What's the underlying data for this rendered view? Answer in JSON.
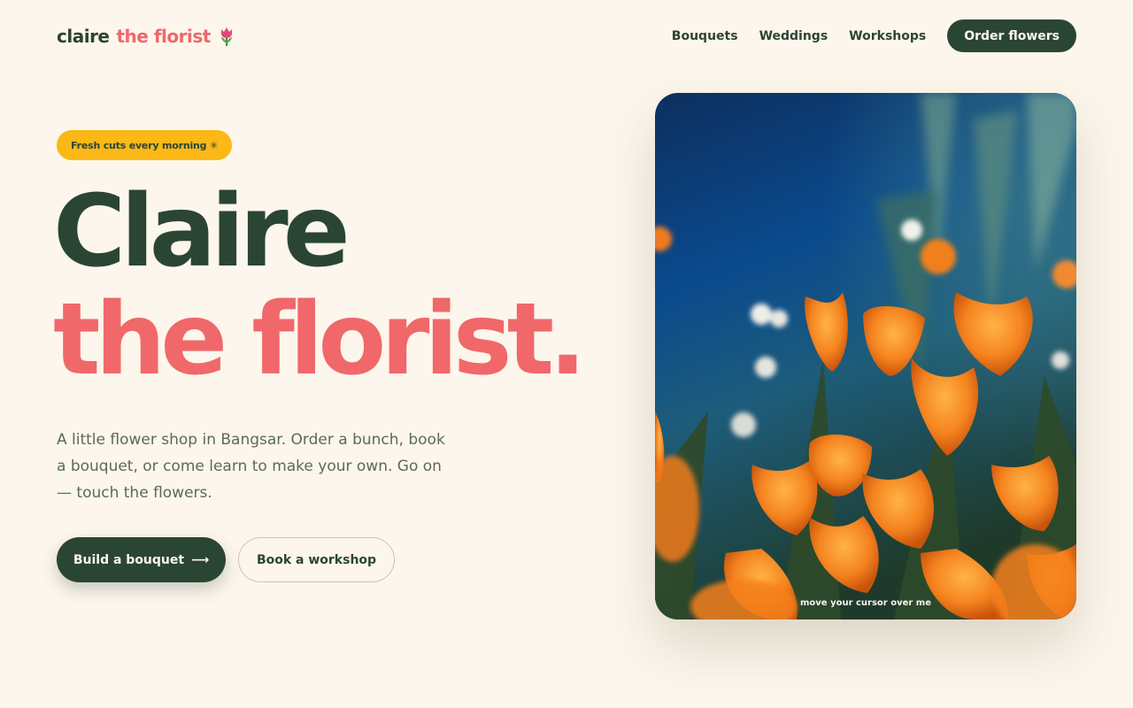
{
  "brand": {
    "part1": "claire",
    "part2": "the florist",
    "icon": "tulip-icon"
  },
  "nav": {
    "links": [
      "Bouquets",
      "Weddings",
      "Workshops"
    ],
    "cta": "Order flowers"
  },
  "hero": {
    "badge": "Fresh cuts every morning ✳",
    "title_line1": "Claire",
    "title_line2": "the florist.",
    "lead": "A little flower shop in Bangsar. Order a bunch, book a bouquet, or come learn to make your own. Go on — touch the flowers.",
    "primary_button": "Build a bouquet",
    "primary_arrow": "⟶",
    "secondary_button": "Book a workshop"
  },
  "photo": {
    "hint": "move your cursor over me",
    "subject": "orange poppies under blue sky"
  },
  "colors": {
    "background": "#fdf6ec",
    "green": "#2b4535",
    "coral": "#f0686a",
    "yellow": "#fbb817"
  }
}
